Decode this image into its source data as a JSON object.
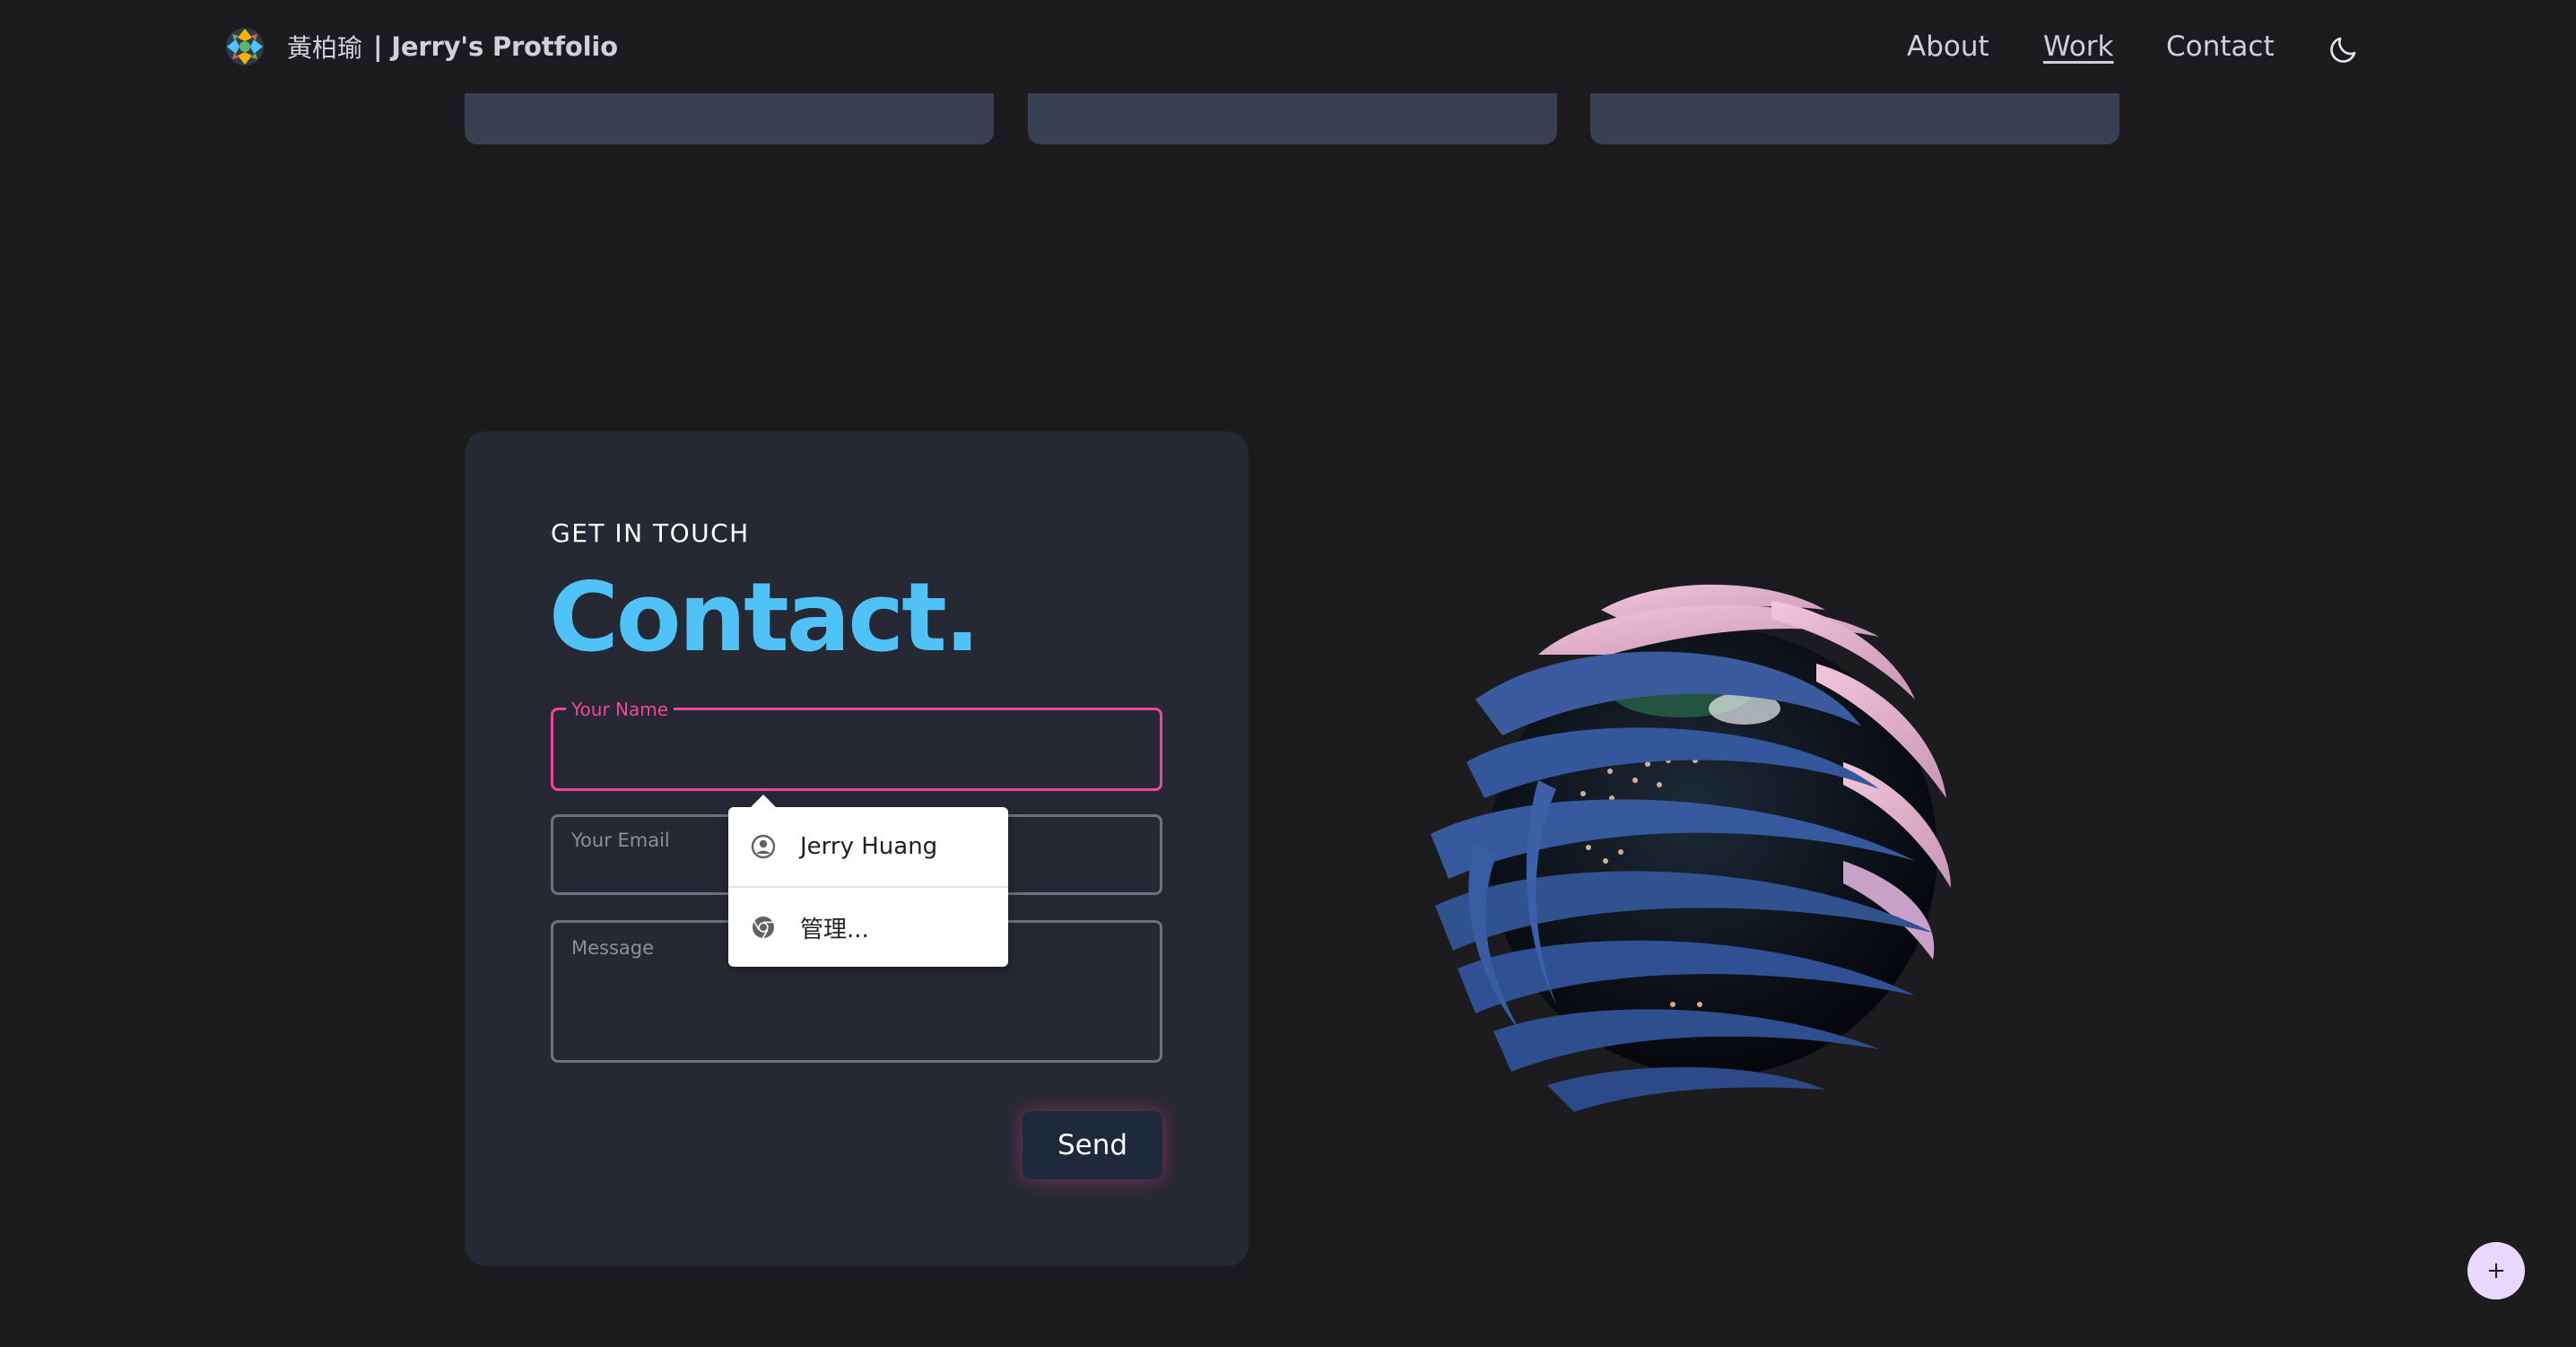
{
  "nav": {
    "brand_cn": "黃柏瑜",
    "brand_en": "| Jerry's Protfolio",
    "links": [
      {
        "label": "About"
      },
      {
        "label": "Work",
        "active": true
      },
      {
        "label": "Contact"
      }
    ],
    "theme_icon": "moon-icon"
  },
  "contact": {
    "eyebrow": "GET IN TOUCH",
    "title": "Contact.",
    "fields": {
      "name_label": "Your Name",
      "email_label": "Your Email",
      "message_label": "Message"
    },
    "send_label": "Send"
  },
  "autofill": {
    "items": [
      {
        "label": "Jerry Huang",
        "icon": "user-circle-icon"
      },
      {
        "label": "管理...",
        "icon": "chrome-icon"
      }
    ]
  },
  "fab": {
    "label": "+"
  },
  "colors": {
    "background": "#1c1c1f",
    "card": "#262933",
    "accent_title": "#4fc3f7",
    "focus_pink": "#ec4899",
    "top_cards": "#374151"
  }
}
